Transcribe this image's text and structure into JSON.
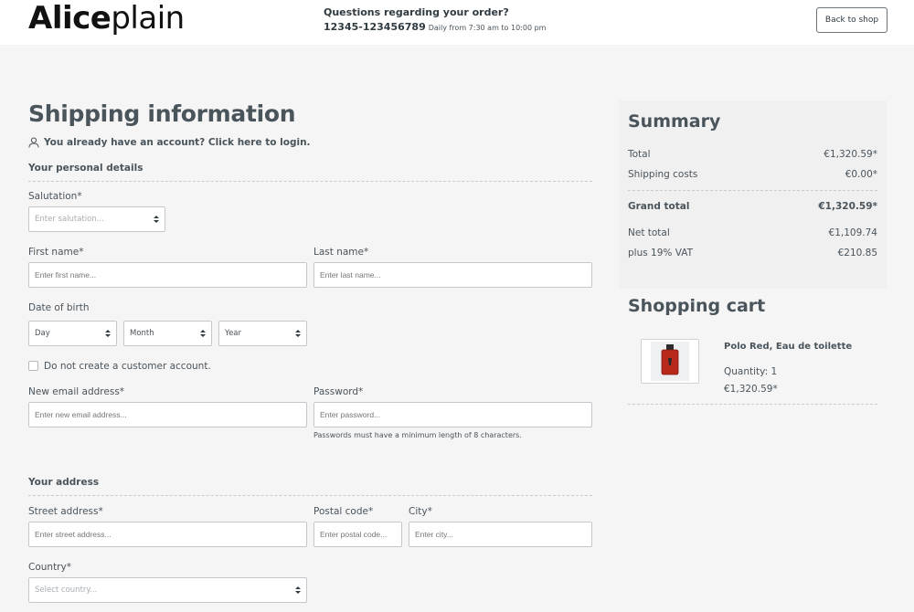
{
  "header": {
    "logo_bold": "Alice",
    "logo_light": "plain",
    "hotline_question": "Questions regarding your order?",
    "hotline_number": "12345-123456789",
    "hotline_hours": "Daily from 7:30 am to 10:00 pm",
    "back_to_shop": "Back to shop"
  },
  "form": {
    "title": "Shipping information",
    "login_prompt": "You already have an account? Click here to login.",
    "personal_section": "Your personal details",
    "salutation_label": "Salutation*",
    "salutation_placeholder": "Enter salutation...",
    "first_name_label": "First name*",
    "first_name_placeholder": "Enter first name...",
    "last_name_label": "Last name*",
    "last_name_placeholder": "Enter last name...",
    "dob_label": "Date of birth",
    "dob_day": "Day",
    "dob_month": "Month",
    "dob_year": "Year",
    "no_account_label": "Do not create a customer account.",
    "email_label": "New email address*",
    "email_placeholder": "Enter new email address...",
    "password_label": "Password*",
    "password_placeholder": "Enter password...",
    "password_hint": "Passwords must have a minimum length of 8 characters.",
    "address_section": "Your address",
    "street_label": "Street address*",
    "street_placeholder": "Enter street address...",
    "postal_label": "Postal code*",
    "postal_placeholder": "Enter postal code...",
    "city_label": "City*",
    "city_placeholder": "Enter city...",
    "country_label": "Country*",
    "country_placeholder": "Select country..."
  },
  "summary": {
    "title": "Summary",
    "rows": [
      {
        "label": "Total",
        "value": "€1,320.59*"
      },
      {
        "label": "Shipping costs",
        "value": "€0.00*"
      },
      {
        "label": "Grand total",
        "value": "€1,320.59*"
      },
      {
        "label": "Net total",
        "value": "€1,109.74"
      },
      {
        "label": "plus 19% VAT",
        "value": "€210.85"
      }
    ]
  },
  "cart": {
    "title": "Shopping cart",
    "item": {
      "name": "Polo Red, Eau de toilette",
      "quantity": "Quantity: 1",
      "price": "€1,320.59*"
    }
  },
  "colors": {
    "text": "#4a545b",
    "background": "#f5f5f6",
    "border": "#c4c8cc"
  }
}
